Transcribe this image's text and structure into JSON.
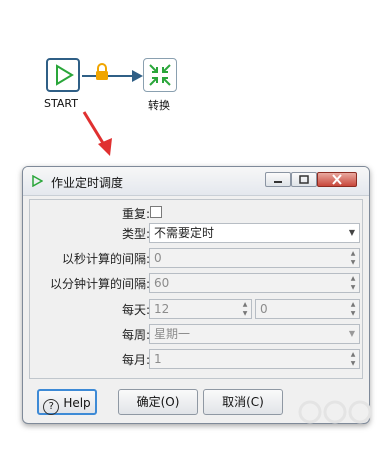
{
  "canvas": {
    "start_label": "START",
    "trans_label": "转换"
  },
  "dialog": {
    "title": "作业定时调度",
    "fields": {
      "repeat_label": "重复:",
      "type_label": "类型:",
      "type_value": "不需要定时",
      "seconds_label": "以秒计算的间隔:",
      "seconds_value": "0",
      "minutes_label": "以分钟计算的间隔:",
      "minutes_value": "60",
      "daily_label": "每天:",
      "daily_hour": "12",
      "daily_min": "0",
      "weekly_label": "每周:",
      "weekly_value": "星期一",
      "monthly_label": "每月:",
      "monthly_value": "1"
    },
    "buttons": {
      "help": "Help",
      "ok": "确定(O)",
      "cancel": "取消(C)"
    }
  },
  "colors": {
    "start_border": "#2f5f86",
    "play_icon": "#2aa63a",
    "lock_icon": "#f0a500",
    "arrow": "#2f5f86",
    "annotation_arrow": "#e03030",
    "help_border": "#3d8ad6"
  }
}
